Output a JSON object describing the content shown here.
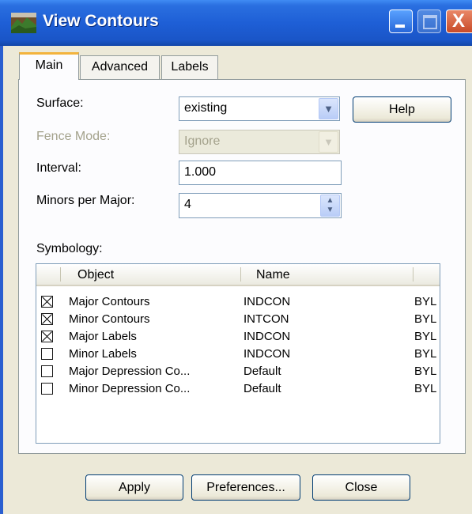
{
  "window": {
    "title": "View Contours",
    "close_glyph": "X"
  },
  "icons": {
    "app": "landscape-icon",
    "minimize": "minimize-icon",
    "maximize": "maximize-icon",
    "close": "close-icon"
  },
  "tabs": [
    {
      "label": "Main",
      "selected": true
    },
    {
      "label": "Advanced",
      "selected": false
    },
    {
      "label": "Labels",
      "selected": false
    }
  ],
  "form": {
    "surface": {
      "label": "Surface:",
      "value": "existing"
    },
    "fence_mode": {
      "label": "Fence Mode:",
      "value": "Ignore",
      "disabled": true
    },
    "interval": {
      "label": "Interval:",
      "value": "1.000"
    },
    "minors_per_major": {
      "label": "Minors per Major:",
      "value": "4"
    }
  },
  "buttons": {
    "help": "Help",
    "apply": "Apply",
    "preferences": "Preferences...",
    "close": "Close"
  },
  "symbology": {
    "label": "Symbology:",
    "columns": [
      "Object",
      "Name"
    ],
    "rows": [
      {
        "checked": true,
        "object": "Major Contours",
        "name": "INDCON",
        "extra": "BYL"
      },
      {
        "checked": true,
        "object": "Minor Contours",
        "name": "INTCON",
        "extra": "BYL"
      },
      {
        "checked": true,
        "object": "Major Labels",
        "name": "INDCON",
        "extra": "BYL"
      },
      {
        "checked": false,
        "object": "Minor Labels",
        "name": "INDCON",
        "extra": "BYL"
      },
      {
        "checked": false,
        "object": "Major Depression Co...",
        "name": "Default",
        "extra": "BYL"
      },
      {
        "checked": false,
        "object": "Minor Depression Co...",
        "name": "Default",
        "extra": "BYL"
      }
    ]
  },
  "colors": {
    "titlebar": "#1e5fd6",
    "dialog_bg": "#ece9d8",
    "tab_accent": "#f3b33d"
  }
}
